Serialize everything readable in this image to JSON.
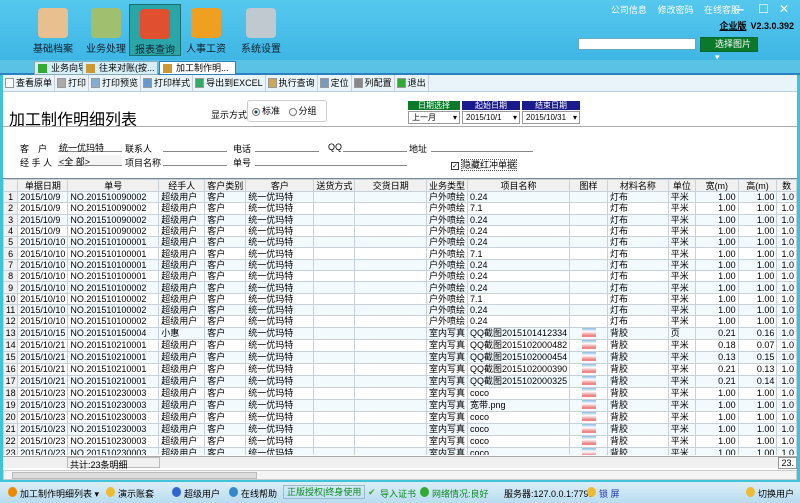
{
  "nav": [
    {
      "label": "基础档案",
      "icon": "basket-icon"
    },
    {
      "label": "业务处理",
      "icon": "calculator-icon"
    },
    {
      "label": "报表查询",
      "icon": "bar-chart-icon",
      "active": true
    },
    {
      "label": "人事工资",
      "icon": "person-icon"
    },
    {
      "label": "系统设置",
      "icon": "gear-icon"
    }
  ],
  "toplinks": [
    "公司信息",
    "修改密码",
    "在线客服"
  ],
  "edition": "企业版",
  "version": "V2.3.0.392",
  "pick_image": "选择图片",
  "tabs": [
    {
      "label": "业务向导"
    },
    {
      "label": "往来对账(按..."
    },
    {
      "label": "加工制作明...",
      "active": true
    }
  ],
  "toolbar": [
    "查看原单",
    "打印",
    "打印预览",
    "打印样式",
    "导出到EXCEL",
    "执行查询",
    "定位",
    "列配置",
    "退出"
  ],
  "page_title": "加工制作明细列表",
  "display_mode": {
    "label": "显示方式",
    "options": [
      "标准",
      "分组"
    ],
    "selected": "标准"
  },
  "date": {
    "select_label": "日期选择",
    "start_label": "起始日期",
    "end_label": "结束日期",
    "select": "上一月",
    "start": "2015/10/1",
    "end": "2015/10/31"
  },
  "filters": {
    "customer_label": "客　户",
    "customer": "统一优玛特",
    "contact_label": "联系人",
    "contact": "",
    "phone_label": "电话",
    "phone": "",
    "qq_label": "QQ",
    "qq": "",
    "address_label": "地址",
    "address": "",
    "handler_label": "经 手 人",
    "handler": "<全 部>",
    "project_label": "项目名称",
    "project": "",
    "docno_label": "单号",
    "docno": "",
    "hide_red": "隐藏红冲单据",
    "hide_red_checked": true
  },
  "columns": [
    "",
    "单据日期",
    "单号",
    "经手人",
    "客户类别",
    "客户",
    "送货方式",
    "交货日期",
    "业务类型",
    "项目名称",
    "图样",
    "材料名称",
    "单位",
    "宽(m)",
    "高(m)",
    "数"
  ],
  "rows": [
    [
      "1",
      "2015/10/9",
      "NO.201510090002",
      "超级用户",
      "客户",
      "统一优玛特",
      "",
      "",
      "户外喷绘",
      "0.24",
      "",
      "灯布",
      "平米",
      "1.00",
      "1.00",
      "1.0"
    ],
    [
      "2",
      "2015/10/9",
      "NO.201510090002",
      "超级用户",
      "客户",
      "统一优玛特",
      "",
      "",
      "户外喷绘",
      "7.1",
      "",
      "灯布",
      "平米",
      "1.00",
      "1.00",
      "1.0"
    ],
    [
      "3",
      "2015/10/9",
      "NO.201510090002",
      "超级用户",
      "客户",
      "统一优玛特",
      "",
      "",
      "户外喷绘",
      "0.24",
      "",
      "灯布",
      "平米",
      "1.00",
      "1.00",
      "1.0"
    ],
    [
      "4",
      "2015/10/9",
      "NO.201510090002",
      "超级用户",
      "客户",
      "统一优玛特",
      "",
      "",
      "户外喷绘",
      "0.24",
      "",
      "灯布",
      "平米",
      "1.00",
      "1.00",
      "1.0"
    ],
    [
      "5",
      "2015/10/10",
      "NO.201510100001",
      "超级用户",
      "客户",
      "统一优玛特",
      "",
      "",
      "户外喷绘",
      "0.24",
      "",
      "灯布",
      "平米",
      "1.00",
      "1.00",
      "1.0"
    ],
    [
      "6",
      "2015/10/10",
      "NO.201510100001",
      "超级用户",
      "客户",
      "统一优玛特",
      "",
      "",
      "户外喷绘",
      "7.1",
      "",
      "灯布",
      "平米",
      "1.00",
      "1.00",
      "1.0"
    ],
    [
      "7",
      "2015/10/10",
      "NO.201510100001",
      "超级用户",
      "客户",
      "统一优玛特",
      "",
      "",
      "户外喷绘",
      "0.24",
      "",
      "灯布",
      "平米",
      "1.00",
      "1.00",
      "1.0"
    ],
    [
      "8",
      "2015/10/10",
      "NO.201510100001",
      "超级用户",
      "客户",
      "统一优玛特",
      "",
      "",
      "户外喷绘",
      "0.24",
      "",
      "灯布",
      "平米",
      "1.00",
      "1.00",
      "1.0"
    ],
    [
      "9",
      "2015/10/10",
      "NO.201510100002",
      "超级用户",
      "客户",
      "统一优玛特",
      "",
      "",
      "户外喷绘",
      "0.24",
      "",
      "灯布",
      "平米",
      "1.00",
      "1.00",
      "1.0"
    ],
    [
      "10",
      "2015/10/10",
      "NO.201510100002",
      "超级用户",
      "客户",
      "统一优玛特",
      "",
      "",
      "户外喷绘",
      "7.1",
      "",
      "灯布",
      "平米",
      "1.00",
      "1.00",
      "1.0"
    ],
    [
      "11",
      "2015/10/10",
      "NO.201510100002",
      "超级用户",
      "客户",
      "统一优玛特",
      "",
      "",
      "户外喷绘",
      "0.24",
      "",
      "灯布",
      "平米",
      "1.00",
      "1.00",
      "1.0"
    ],
    [
      "12",
      "2015/10/10",
      "NO.201510100002",
      "超级用户",
      "客户",
      "统一优玛特",
      "",
      "",
      "户外喷绘",
      "0.24",
      "",
      "灯布",
      "平米",
      "1.00",
      "1.00",
      "1.0"
    ],
    [
      "13",
      "2015/10/15",
      "NO.201510150004",
      "小惠",
      "客户",
      "统一优玛特",
      "",
      "",
      "室内写真",
      "QQ截图2015101412334",
      "img",
      "背胶",
      "页",
      "0.21",
      "0.16",
      "1.0"
    ],
    [
      "14",
      "2015/10/21",
      "NO.201510210001",
      "超级用户",
      "客户",
      "统一优玛特",
      "",
      "",
      "室内写真",
      "QQ截图2015102000482",
      "img",
      "背胶",
      "平米",
      "0.18",
      "0.07",
      "1.0"
    ],
    [
      "15",
      "2015/10/21",
      "NO.201510210001",
      "超级用户",
      "客户",
      "统一优玛特",
      "",
      "",
      "室内写真",
      "QQ截图2015102000454",
      "img",
      "背胶",
      "平米",
      "0.13",
      "0.15",
      "1.0"
    ],
    [
      "16",
      "2015/10/21",
      "NO.201510210001",
      "超级用户",
      "客户",
      "统一优玛特",
      "",
      "",
      "室内写真",
      "QQ截图2015102000390",
      "img",
      "背胶",
      "平米",
      "0.21",
      "0.13",
      "1.0"
    ],
    [
      "17",
      "2015/10/21",
      "NO.201510210001",
      "超级用户",
      "客户",
      "统一优玛特",
      "",
      "",
      "室内写真",
      "QQ截图2015102000325",
      "img",
      "背胶",
      "平米",
      "0.21",
      "0.14",
      "1.0"
    ],
    [
      "18",
      "2015/10/23",
      "NO.201510230003",
      "超级用户",
      "客户",
      "统一优玛特",
      "",
      "",
      "室内写真",
      "coco",
      "img",
      "背胶",
      "平米",
      "1.00",
      "1.00",
      "1.0"
    ],
    [
      "19",
      "2015/10/23",
      "NO.201510230003",
      "超级用户",
      "客户",
      "统一优玛特",
      "",
      "",
      "室内写真",
      "宽带.png",
      "img",
      "背胶",
      "平米",
      "1.00",
      "1.00",
      "1.0"
    ],
    [
      "20",
      "2015/10/23",
      "NO.201510230003",
      "超级用户",
      "客户",
      "统一优玛特",
      "",
      "",
      "室内写真",
      "coco",
      "img",
      "背胶",
      "平米",
      "1.00",
      "1.00",
      "1.0"
    ],
    [
      "21",
      "2015/10/23",
      "NO.201510230003",
      "超级用户",
      "客户",
      "统一优玛特",
      "",
      "",
      "室内写真",
      "coco",
      "img",
      "背胶",
      "平米",
      "1.00",
      "1.00",
      "1.0"
    ],
    [
      "22",
      "2015/10/23",
      "NO.201510230003",
      "超级用户",
      "客户",
      "统一优玛特",
      "",
      "",
      "室内写真",
      "coco",
      "img",
      "背胶",
      "平米",
      "1.00",
      "1.00",
      "1.0"
    ],
    [
      "23",
      "2015/10/23",
      "NO.201510230003",
      "超级用户",
      "客户",
      "统一优玛特",
      "",
      "",
      "室内写真",
      "coco",
      "img",
      "背胶",
      "平米",
      "1.00",
      "1.00",
      "1.0"
    ]
  ],
  "total_label": "共计:23条明细",
  "total_right": "23.",
  "status": {
    "report": "加工制作明细列表",
    "account": "演示账套",
    "user": "超级用户",
    "help": "在线帮助",
    "license": "正版授权|终身使用",
    "import_cert": "导入证书",
    "network": "网络情况:良好",
    "server": "服务器:127.0.0.1:7798",
    "lock": "锁 屏",
    "switch_user": "切换用户"
  },
  "colors": {
    "header_bg": "#4ec0ea",
    "date_select_bg": "#0a7a2a",
    "date_range_bg": "#1a1a8a",
    "active_nav": "#2aa6a8"
  }
}
